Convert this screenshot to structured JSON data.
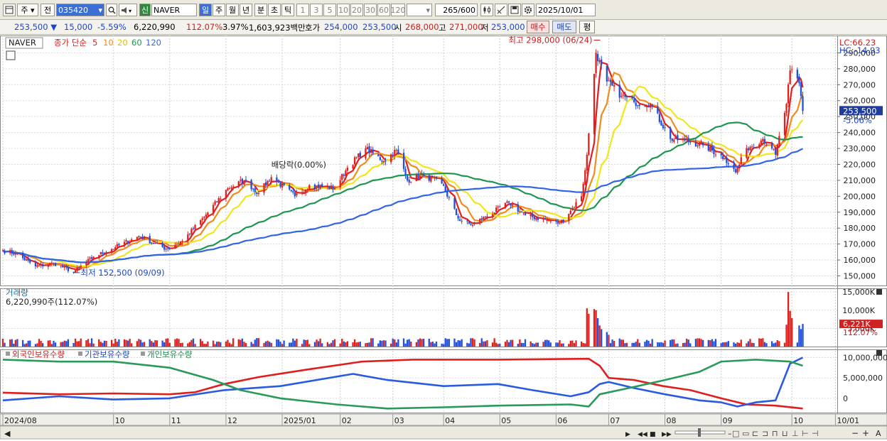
{
  "toolbar": {
    "market": "주",
    "prev": "전",
    "code": "035420",
    "new_badge": "신",
    "name": "NAVER",
    "periods": [
      "일",
      "주",
      "월",
      "년",
      "분",
      "초",
      "틱"
    ],
    "active_period": "일",
    "minutes": [
      "1",
      "3",
      "5",
      "10",
      "20",
      "30",
      "60",
      "120"
    ],
    "count": "265",
    "count_total": "/600",
    "date": "2025/10/01"
  },
  "quote": {
    "price": "253,500",
    "change": "15,000",
    "change_pct": "-5.59%",
    "volume": "6,220,990",
    "volume_ratio": "112.07%",
    "turnover_ratio": "3.97%",
    "amount": "1,603,923백만",
    "quote_label": "호가",
    "ask": "254,000",
    "bid": "253,500",
    "open_label": "시",
    "open": "268,000",
    "high_label": "고",
    "high": "271,000",
    "low_label": "저",
    "low": "253,000",
    "buy_button": "매수",
    "sell_button": "매도",
    "eval_button": "평"
  },
  "colors": {
    "up": "#e0201c",
    "down": "#2050e0",
    "ma5": "#e02020",
    "ma10": "#f08c1e",
    "ma20": "#f0e61e",
    "ma60": "#1e9650",
    "ma120": "#3264e6",
    "price_tag": "#1e3ca0",
    "vol_tag": "#d02020"
  },
  "chart_data": [
    {
      "type": "candlestick",
      "legend": {
        "name": "NAVER",
        "prefix": "종가 단순",
        "periods": [
          "5",
          "10",
          "20",
          "60",
          "120"
        ]
      },
      "right_labels": {
        "lc": "LC:66.23",
        "hc": "HC:-14.93"
      },
      "ylim": [
        144000,
        300000
      ],
      "yticks": [
        150000,
        160000,
        170000,
        180000,
        190000,
        200000,
        210000,
        220000,
        230000,
        240000,
        250000,
        260000,
        270000,
        280000,
        290000
      ],
      "ytick_labels": [
        "150,000",
        "160,000",
        "170,000",
        "180,000",
        "190,000",
        "200,000",
        "210,000",
        "220,000",
        "230,000",
        "240,000",
        "250,000",
        "260,000",
        "270,000",
        "280,000",
        "290,000"
      ],
      "current_price": 253500,
      "current_price_label": "253,500",
      "current_change_label": "-5.06%",
      "anchors": [
        [
          "2024-08-01",
          166000
        ],
        [
          "2024-08-08",
          164000
        ],
        [
          "2024-08-19",
          156000
        ],
        [
          "2024-08-29",
          158000
        ],
        [
          "2024-09-09",
          152500
        ],
        [
          "2024-09-20",
          162000
        ],
        [
          "2024-10-02",
          168000
        ],
        [
          "2024-10-15",
          175000
        ],
        [
          "2024-10-30",
          167000
        ],
        [
          "2024-11-08",
          172000
        ],
        [
          "2024-11-20",
          187000
        ],
        [
          "2024-12-03",
          205000
        ],
        [
          "2024-12-12",
          210000
        ],
        [
          "2024-12-20",
          202000
        ],
        [
          "2024-12-27",
          212000
        ],
        [
          "2025-01-09",
          200000
        ],
        [
          "2025-01-17",
          207000
        ],
        [
          "2025-01-31",
          205000
        ],
        [
          "2025-02-07",
          218000
        ],
        [
          "2025-02-17",
          230000
        ],
        [
          "2025-02-27",
          222000
        ],
        [
          "2025-03-06",
          229000
        ],
        [
          "2025-03-12",
          210000
        ],
        [
          "2025-03-21",
          213000
        ],
        [
          "2025-03-31",
          208000
        ],
        [
          "2025-04-09",
          186000
        ],
        [
          "2025-04-16",
          182000
        ],
        [
          "2025-04-24",
          187000
        ],
        [
          "2025-05-07",
          196000
        ],
        [
          "2025-05-16",
          188000
        ],
        [
          "2025-05-28",
          185000
        ],
        [
          "2025-06-04",
          183000
        ],
        [
          "2025-06-10",
          191000
        ],
        [
          "2025-06-16",
          200000
        ],
        [
          "2025-06-19",
          226000
        ],
        [
          "2025-06-24",
          290000
        ],
        [
          "2025-06-30",
          272000
        ],
        [
          "2025-07-08",
          263000
        ],
        [
          "2025-07-15",
          259000
        ],
        [
          "2025-07-24",
          258000
        ],
        [
          "2025-08-04",
          236000
        ],
        [
          "2025-08-12",
          235000
        ],
        [
          "2025-08-22",
          232000
        ],
        [
          "2025-09-03",
          224000
        ],
        [
          "2025-09-09",
          215000
        ],
        [
          "2025-09-15",
          230000
        ],
        [
          "2025-09-24",
          236000
        ],
        [
          "2025-09-29",
          230000
        ],
        [
          "2025-10-01",
          226000
        ],
        [
          "2025-10-07",
          258000
        ],
        [
          "2025-10-09",
          279000
        ],
        [
          "2025-10-14",
          271000
        ],
        [
          "2025-10-16",
          253500
        ]
      ],
      "moving_averages": [
        {
          "period": 5,
          "color_key": "ma5"
        },
        {
          "period": 10,
          "color_key": "ma10"
        },
        {
          "period": 20,
          "color_key": "ma20"
        },
        {
          "period": 60,
          "color_key": "ma60"
        },
        {
          "period": 120,
          "color_key": "ma120"
        }
      ],
      "annotations": [
        {
          "text": "최고 298,000 (06/24)",
          "date": "2025-06-24",
          "value": 298000
        },
        {
          "text": "최저 152,500 (09/09)",
          "date": "2024-09-09",
          "value": 152500
        },
        {
          "text": "배당락(0.00%)",
          "date": "2024-12-27",
          "value": 218000
        }
      ]
    },
    {
      "type": "bar",
      "title": "거래량",
      "value_label": "6,220,990주(112.07%)",
      "ylim": [
        0,
        16000000
      ],
      "yticks": [
        5000000,
        10000000,
        15000000
      ],
      "ytick_labels": [
        "5,000K",
        "10,000K",
        "15,000K"
      ],
      "current_label": "6,221K",
      "current_pct_label": "112.07%",
      "base_volume": 1500000,
      "spikes": [
        [
          "2025-06-19",
          10500000
        ],
        [
          "2025-06-20",
          9000000
        ],
        [
          "2025-06-23",
          10300000
        ],
        [
          "2025-06-24",
          10000000
        ],
        [
          "2025-06-25",
          7800000
        ],
        [
          "2025-06-26",
          5800000
        ],
        [
          "2025-06-27",
          4800000
        ],
        [
          "2025-06-30",
          4000000
        ],
        [
          "2025-07-01",
          3200000
        ],
        [
          "2025-10-07",
          6000000
        ],
        [
          "2025-10-08",
          15000000
        ],
        [
          "2025-10-09",
          9800000
        ],
        [
          "2025-10-10",
          7800000
        ],
        [
          "2025-10-14",
          5800000
        ],
        [
          "2025-10-15",
          4800000
        ],
        [
          "2025-10-16",
          6220990
        ]
      ]
    },
    {
      "type": "line",
      "legend": [
        "외국인보유수량",
        "기관보유수량",
        "개인보유수량"
      ],
      "ylim": [
        -3500000,
        12000000
      ],
      "yticks": [
        0,
        5000000,
        10000000
      ],
      "ytick_labels": [
        "0",
        "5,000,000",
        "10,000,000"
      ],
      "series": [
        {
          "name": "외국인보유수량",
          "color": "#e01e1e",
          "points": [
            [
              "2024-08-01",
              1400000
            ],
            [
              "2024-09-01",
              1000000
            ],
            [
              "2024-10-01",
              1200000
            ],
            [
              "2024-11-01",
              1000000
            ],
            [
              "2024-11-15",
              1500000
            ],
            [
              "2024-12-01",
              3500000
            ],
            [
              "2024-12-20",
              5200000
            ],
            [
              "2025-01-15",
              7000000
            ],
            [
              "2025-02-15",
              9000000
            ],
            [
              "2025-03-15",
              9500000
            ],
            [
              "2025-05-01",
              9500000
            ],
            [
              "2025-06-20",
              9700000
            ],
            [
              "2025-06-26",
              8000000
            ],
            [
              "2025-07-01",
              5000000
            ],
            [
              "2025-07-15",
              4500000
            ],
            [
              "2025-07-31",
              3000000
            ],
            [
              "2025-08-15",
              2000000
            ],
            [
              "2025-09-01",
              0
            ],
            [
              "2025-09-15",
              -1500000
            ],
            [
              "2025-10-01",
              -1800000
            ],
            [
              "2025-10-16",
              -2500000
            ]
          ]
        },
        {
          "name": "기관보유수량",
          "color": "#2a5ae0",
          "points": [
            [
              "2024-08-01",
              -500000
            ],
            [
              "2024-09-01",
              500000
            ],
            [
              "2024-10-01",
              -300000
            ],
            [
              "2024-11-01",
              0
            ],
            [
              "2024-12-01",
              2000000
            ],
            [
              "2025-01-01",
              3000000
            ],
            [
              "2025-02-10",
              6000000
            ],
            [
              "2025-03-01",
              4500000
            ],
            [
              "2025-04-01",
              3000000
            ],
            [
              "2025-05-01",
              3500000
            ],
            [
              "2025-05-20",
              2000000
            ],
            [
              "2025-06-10",
              500000
            ],
            [
              "2025-06-20",
              1500000
            ],
            [
              "2025-06-26",
              3500000
            ],
            [
              "2025-07-01",
              4000000
            ],
            [
              "2025-07-15",
              2500000
            ],
            [
              "2025-08-01",
              1000000
            ],
            [
              "2025-08-20",
              -500000
            ],
            [
              "2025-09-01",
              -1000000
            ],
            [
              "2025-09-10",
              -2000000
            ],
            [
              "2025-09-20",
              -1000000
            ],
            [
              "2025-10-01",
              -500000
            ],
            [
              "2025-10-09",
              8500000
            ],
            [
              "2025-10-16",
              10000000
            ]
          ]
        },
        {
          "name": "개인보유수량",
          "color": "#2a9a5a",
          "points": [
            [
              "2024-08-01",
              9500000
            ],
            [
              "2024-09-01",
              9000000
            ],
            [
              "2024-10-01",
              9000000
            ],
            [
              "2024-11-01",
              7500000
            ],
            [
              "2024-11-25",
              4500000
            ],
            [
              "2024-12-10",
              2000000
            ],
            [
              "2025-01-01",
              0
            ],
            [
              "2025-02-01",
              -1500000
            ],
            [
              "2025-03-01",
              -2500000
            ],
            [
              "2025-04-01",
              -2200000
            ],
            [
              "2025-05-01",
              -1800000
            ],
            [
              "2025-06-10",
              -1500000
            ],
            [
              "2025-06-20",
              -2000000
            ],
            [
              "2025-06-26",
              1000000
            ],
            [
              "2025-07-15",
              2800000
            ],
            [
              "2025-08-01",
              4500000
            ],
            [
              "2025-08-20",
              6500000
            ],
            [
              "2025-09-01",
              9000000
            ],
            [
              "2025-09-20",
              9500000
            ],
            [
              "2025-10-09",
              9000000
            ],
            [
              "2025-10-16",
              8000000
            ]
          ]
        }
      ]
    }
  ],
  "x_axis": {
    "ticks": [
      {
        "date": "2024-08-01",
        "label": "2024/08"
      },
      {
        "date": "2024-10-01",
        "label": "10"
      },
      {
        "date": "2024-11-01",
        "label": "11"
      },
      {
        "date": "2024-12-02",
        "label": "12"
      },
      {
        "date": "2025-01-02",
        "label": "2025/01"
      },
      {
        "date": "2025-02-03",
        "label": "02"
      },
      {
        "date": "2025-03-04",
        "label": "03"
      },
      {
        "date": "2025-04-01",
        "label": "04"
      },
      {
        "date": "2025-05-02",
        "label": "05"
      },
      {
        "date": "2025-06-02",
        "label": "06"
      },
      {
        "date": "2025-07-01",
        "label": "07"
      },
      {
        "date": "2025-08-01",
        "label": "08"
      },
      {
        "date": "2025-09-01",
        "label": "09"
      },
      {
        "date": "2025-10-10",
        "label": "10"
      },
      {
        "date": "2025-11-03",
        "label": "10/01"
      }
    ],
    "start": "2024-08-01",
    "end": "2025-11-04"
  },
  "icons": [
    "chart-type-icon",
    "search-icon",
    "speaker-icon",
    "candle-icon",
    "crosshair-icon",
    "save-icon",
    "settings-icon",
    "grid-icon",
    "scroll-left-icon",
    "scroll-right-icon",
    "zoom-in-icon",
    "zoom-out-icon"
  ]
}
